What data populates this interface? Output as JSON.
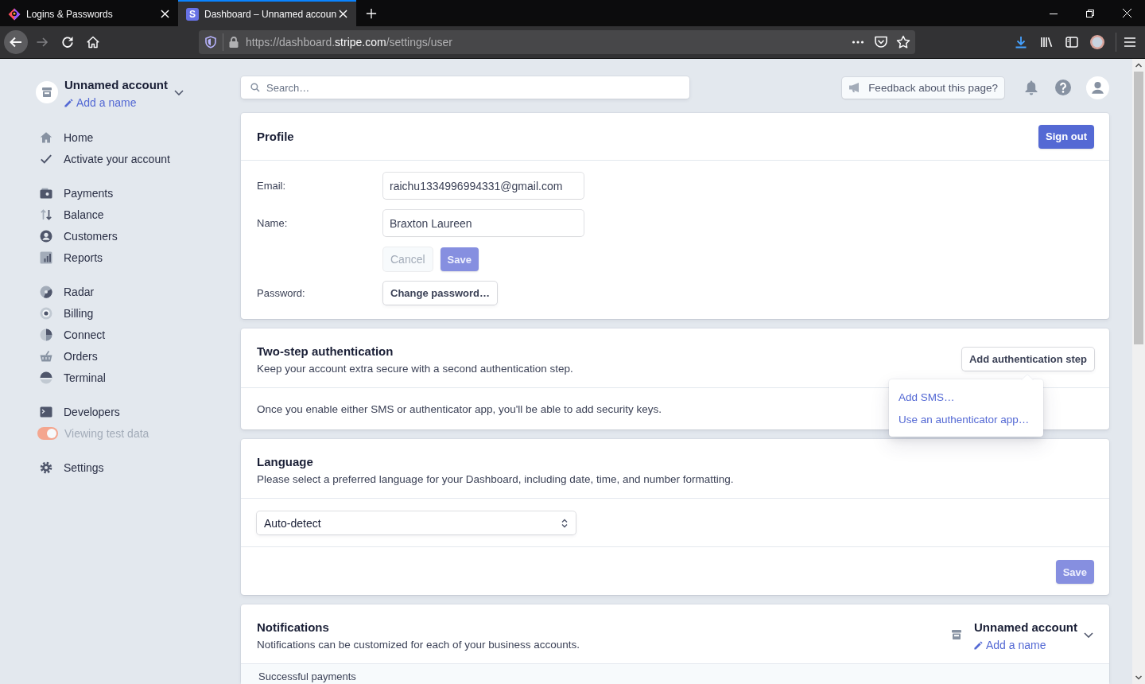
{
  "browser": {
    "tabs": [
      {
        "title": "Logins & Passwords",
        "selected": false
      },
      {
        "title": "Dashboard – Unnamed accoun",
        "selected": true,
        "logo_letter": "S"
      }
    ],
    "url": [
      {
        "text": "https://dashboard.",
        "highlight": false
      },
      {
        "text": "stripe.com",
        "highlight": true
      },
      {
        "text": "/settings/user",
        "highlight": false
      }
    ]
  },
  "sidebar": {
    "account": {
      "name": "Unnamed account",
      "link": "Add a name"
    },
    "groups": [
      [
        {
          "label": "Home",
          "kind": "link"
        },
        {
          "label": "Activate your account",
          "kind": "link"
        }
      ],
      [
        {
          "label": "Payments",
          "kind": "link"
        },
        {
          "label": "Balance",
          "kind": "link"
        },
        {
          "label": "Customers",
          "kind": "link"
        },
        {
          "label": "Reports",
          "kind": "link"
        }
      ],
      [
        {
          "label": "Radar",
          "kind": "link"
        },
        {
          "label": "Billing",
          "kind": "link"
        },
        {
          "label": "Connect",
          "kind": "link"
        },
        {
          "label": "Orders",
          "kind": "link"
        },
        {
          "label": "Terminal",
          "kind": "link"
        }
      ],
      [
        {
          "label": "Developers",
          "kind": "link"
        },
        {
          "label": "Viewing test data",
          "kind": "toggle",
          "on": true
        }
      ],
      [
        {
          "label": "Settings",
          "kind": "link"
        }
      ]
    ]
  },
  "header": {
    "search": {
      "placeholder": "Search…"
    },
    "feedback": "Feedback about this page?"
  },
  "profile": {
    "title": "Profile",
    "sign_out": {
      "label": "Sign out",
      "kind": "primary",
      "disabled": false
    },
    "fields": [
      {
        "label": "Email:",
        "value": "raichu1334996994331@gmail.com"
      },
      {
        "label": "Name:",
        "value": "Braxton Laureen"
      }
    ],
    "actions": [
      {
        "label": "Cancel",
        "kind": "secondary",
        "disabled": true
      },
      {
        "label": "Save",
        "kind": "primary",
        "disabled": true
      }
    ],
    "password": {
      "label": "Password:",
      "button": {
        "label": "Change password…",
        "kind": "secondary",
        "disabled": false
      }
    }
  },
  "two_step": {
    "title": "Two-step authentication",
    "description": "Keep your account extra secure with a second authentication step.",
    "button": {
      "label": "Add authentication step",
      "kind": "secondary",
      "disabled": false
    },
    "note": "Once you enable either SMS or authenticator app, you'll be able to add security keys.",
    "menu": {
      "open": true,
      "items": [
        "Add SMS…",
        "Use an authenticator app…"
      ]
    }
  },
  "language": {
    "title": "Language",
    "description": "Please select a preferred language for your Dashboard, including date, time, and number formatting.",
    "select": {
      "value": "Auto-detect"
    },
    "save": {
      "label": "Save",
      "kind": "primary",
      "disabled": true
    }
  },
  "notifications": {
    "title": "Notifications",
    "description": "Notifications can be customized for each of your business accounts.",
    "account": {
      "name": "Unnamed account",
      "link": "Add a name"
    },
    "section": "Successful payments"
  }
}
